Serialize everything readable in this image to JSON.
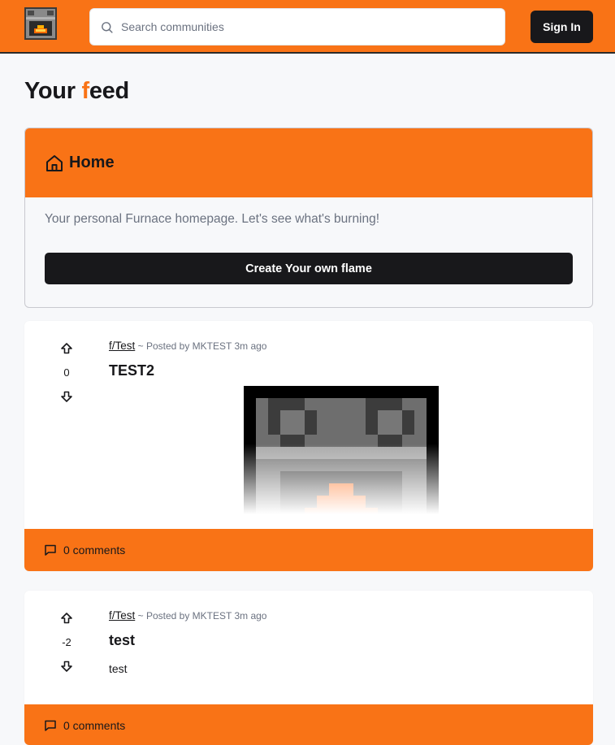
{
  "header": {
    "search_placeholder": "Search communities",
    "sign_in_label": "Sign In",
    "logo_icon": "furnace-logo-icon",
    "accent_color": "#f97316"
  },
  "page": {
    "title_before": "Your ",
    "title_accent": "f",
    "title_after": "eed"
  },
  "home_card": {
    "title": "Home",
    "icon": "home-icon",
    "description": "Your personal Furnace homepage. Let's see what's burning!",
    "create_button_label": "Create Your own flame"
  },
  "posts": [
    {
      "community": "f/Test",
      "meta": "~ Posted by MKTEST 3m ago",
      "title": "TEST2",
      "votes": "0",
      "has_image": true,
      "comments_label": "0 comments"
    },
    {
      "community": "f/Test",
      "meta": "~ Posted by MKTEST 3m ago",
      "title": "test",
      "votes": "-2",
      "body": "test",
      "comments_label": "0 comments"
    }
  ]
}
